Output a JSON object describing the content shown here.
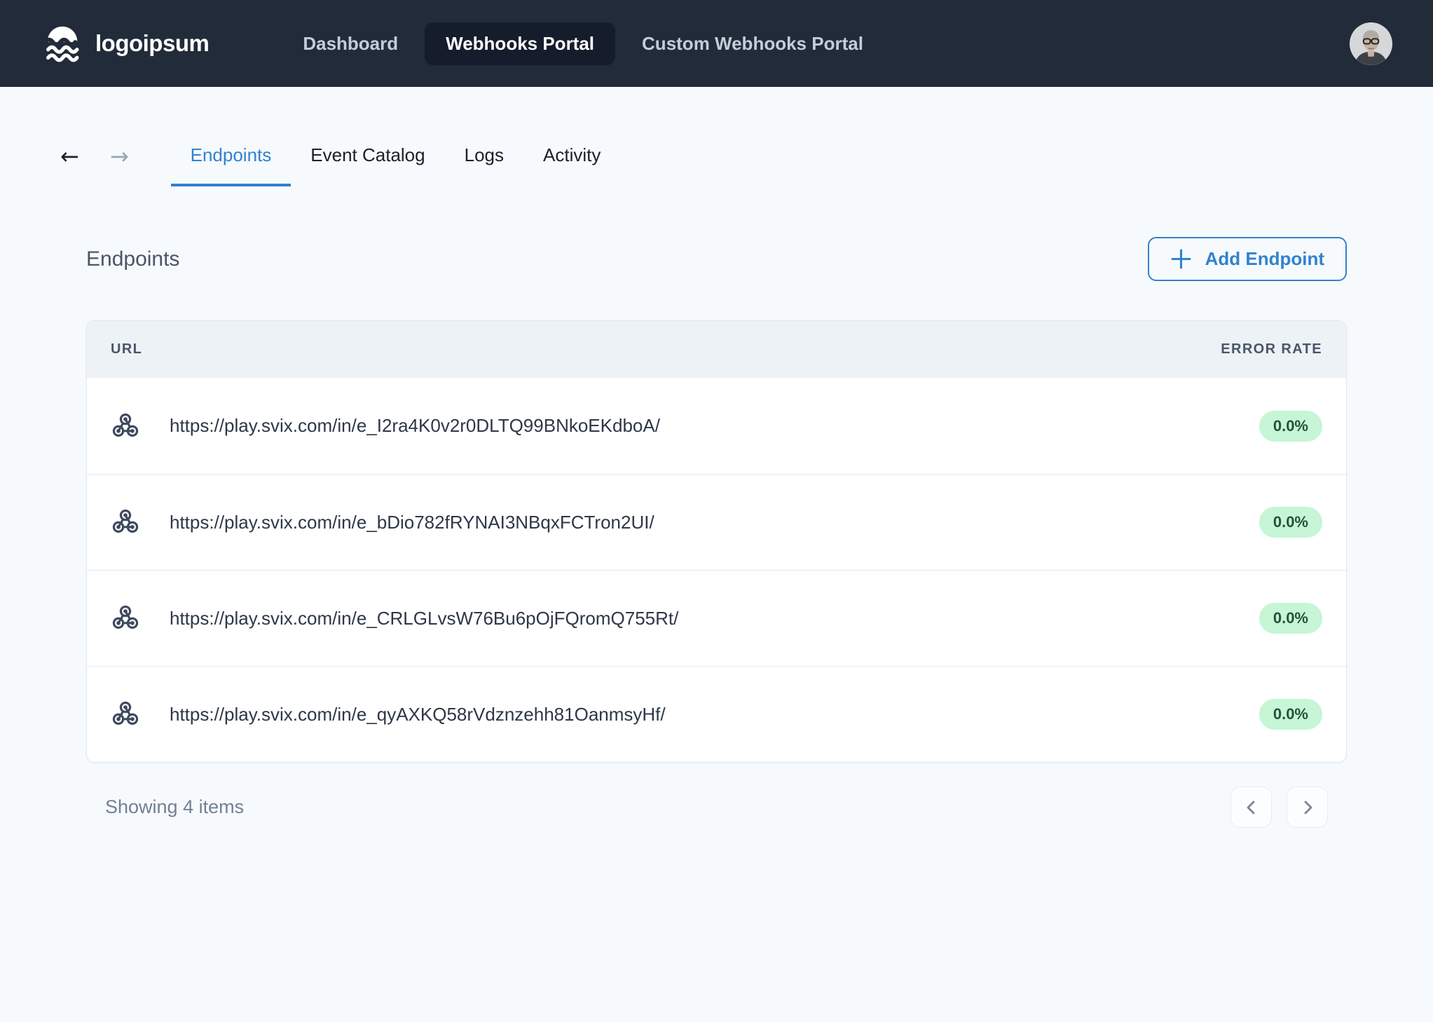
{
  "navbar": {
    "logo_text": "logoipsum",
    "items": [
      {
        "label": "Dashboard",
        "active": false
      },
      {
        "label": "Webhooks Portal",
        "active": true
      },
      {
        "label": "Custom Webhooks Portal",
        "active": false
      }
    ]
  },
  "tabs": {
    "back_glyph": "←",
    "forward_glyph": "→",
    "items": [
      {
        "label": "Endpoints",
        "active": true
      },
      {
        "label": "Event Catalog",
        "active": false
      },
      {
        "label": "Logs",
        "active": false
      },
      {
        "label": "Activity",
        "active": false
      }
    ]
  },
  "page": {
    "title": "Endpoints",
    "add_button_label": "Add Endpoint"
  },
  "table": {
    "columns": [
      "URL",
      "ERROR RATE"
    ],
    "rows": [
      {
        "url": "https://play.svix.com/in/e_I2ra4K0v2r0DLTQ99BNkoEKdboA/",
        "error_rate": "0.0%"
      },
      {
        "url": "https://play.svix.com/in/e_bDio782fRYNAI3NBqxFCTron2UI/",
        "error_rate": "0.0%"
      },
      {
        "url": "https://play.svix.com/in/e_CRLGLvsW76Bu6pOjFQromQ755Rt/",
        "error_rate": "0.0%"
      },
      {
        "url": "https://play.svix.com/in/e_qyAXKQ58rVdznzehh81OanmsyHf/",
        "error_rate": "0.0%"
      }
    ]
  },
  "footer": {
    "summary": "Showing 4 items"
  },
  "icons": {
    "logo": "waves-logo",
    "row_icon": "webhook-icon",
    "back": "arrow-left-icon",
    "forward": "arrow-right-icon",
    "add": "plus-icon",
    "prev": "chevron-left-icon",
    "next": "chevron-right-icon",
    "avatar": "user-photo"
  },
  "colors": {
    "navbar_bg": "#222B3A",
    "navbar_active_bg": "#151C2B",
    "accent_blue": "#3182CE",
    "badge_bg": "#C6F6D5",
    "badge_text": "#22543D",
    "page_bg": "#F7FAFC",
    "table_header_bg": "#EDF2F7",
    "border": "#E2E8F0"
  }
}
